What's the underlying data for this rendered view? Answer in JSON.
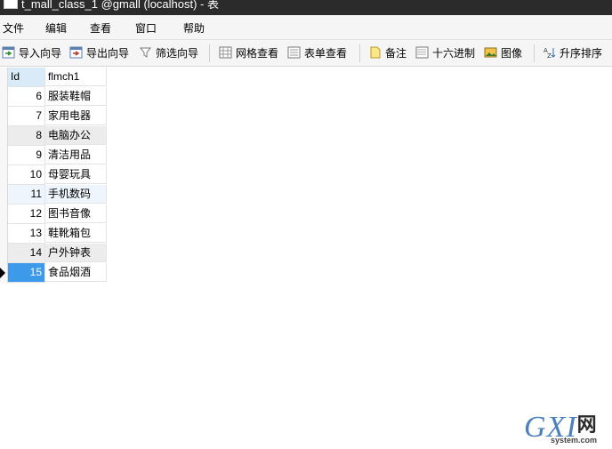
{
  "window": {
    "title": "t_mall_class_1 @gmall (localhost) - 表"
  },
  "menu": {
    "items": [
      "文件",
      "编辑",
      "查看",
      "窗口",
      "帮助"
    ]
  },
  "toolbar": {
    "import_wizard": "导入向导",
    "export_wizard": "导出向导",
    "filter_wizard": "筛选向导",
    "grid_view": "网格查看",
    "form_view": "表单查看",
    "memo": "备注",
    "hex": "十六进制",
    "image": "图像",
    "sort_asc": "升序排序"
  },
  "table": {
    "columns": [
      "Id",
      "flmch1"
    ],
    "rows": [
      {
        "id": "6",
        "name": "服装鞋帽"
      },
      {
        "id": "7",
        "name": "家用电器"
      },
      {
        "id": "8",
        "name": "电脑办公"
      },
      {
        "id": "9",
        "name": "清洁用品"
      },
      {
        "id": "10",
        "name": "母婴玩具"
      },
      {
        "id": "11",
        "name": "手机数码"
      },
      {
        "id": "12",
        "name": "图书音像"
      },
      {
        "id": "13",
        "name": "鞋靴箱包"
      },
      {
        "id": "14",
        "name": "户外钟表"
      },
      {
        "id": "15",
        "name": "食品烟酒"
      }
    ],
    "selected_id": "15"
  },
  "watermark": {
    "logo": "GXI",
    "logo_cn": "网",
    "site": "system.com"
  },
  "colors": {
    "selection": "#3d9aea",
    "header_highlight": "#d9ebf9",
    "titlebar": "#2b2b2b"
  }
}
